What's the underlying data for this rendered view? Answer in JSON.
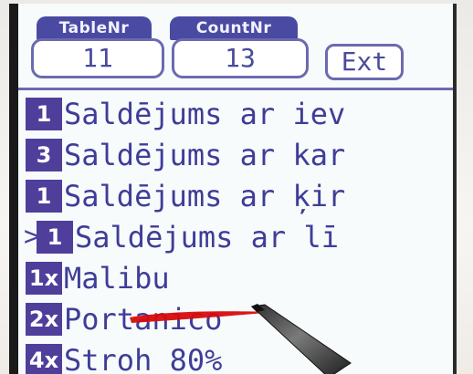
{
  "header": {
    "table_label": "TableNr",
    "count_label": "CountNr",
    "table_value": "11",
    "count_value": "13",
    "ext_label": "Ext"
  },
  "items": [
    {
      "qty": "1",
      "name": "Saldējums ar iev",
      "selected": false
    },
    {
      "qty": "3",
      "name": "Saldējums ar kar",
      "selected": false
    },
    {
      "qty": "1",
      "name": "Saldējums ar ķir",
      "selected": false
    },
    {
      "qty": "1",
      "name": "Saldējums ar lī",
      "selected": true,
      "marker": ">"
    },
    {
      "qty": "1x",
      "name": "Malibu",
      "selected": false
    },
    {
      "qty": "2x",
      "name": "Portanico",
      "selected": false
    },
    {
      "qty": "4x",
      "name": "Stroh 80%",
      "selected": false
    }
  ],
  "colors": {
    "accent": "#4f3f9b",
    "text": "#3f3d97",
    "screen_bg": "#f7fbfc",
    "red_mark": "#d80b0b"
  },
  "icons": {
    "stylus": "stylus-pen-icon",
    "annotation": "red-scribble-mark"
  }
}
